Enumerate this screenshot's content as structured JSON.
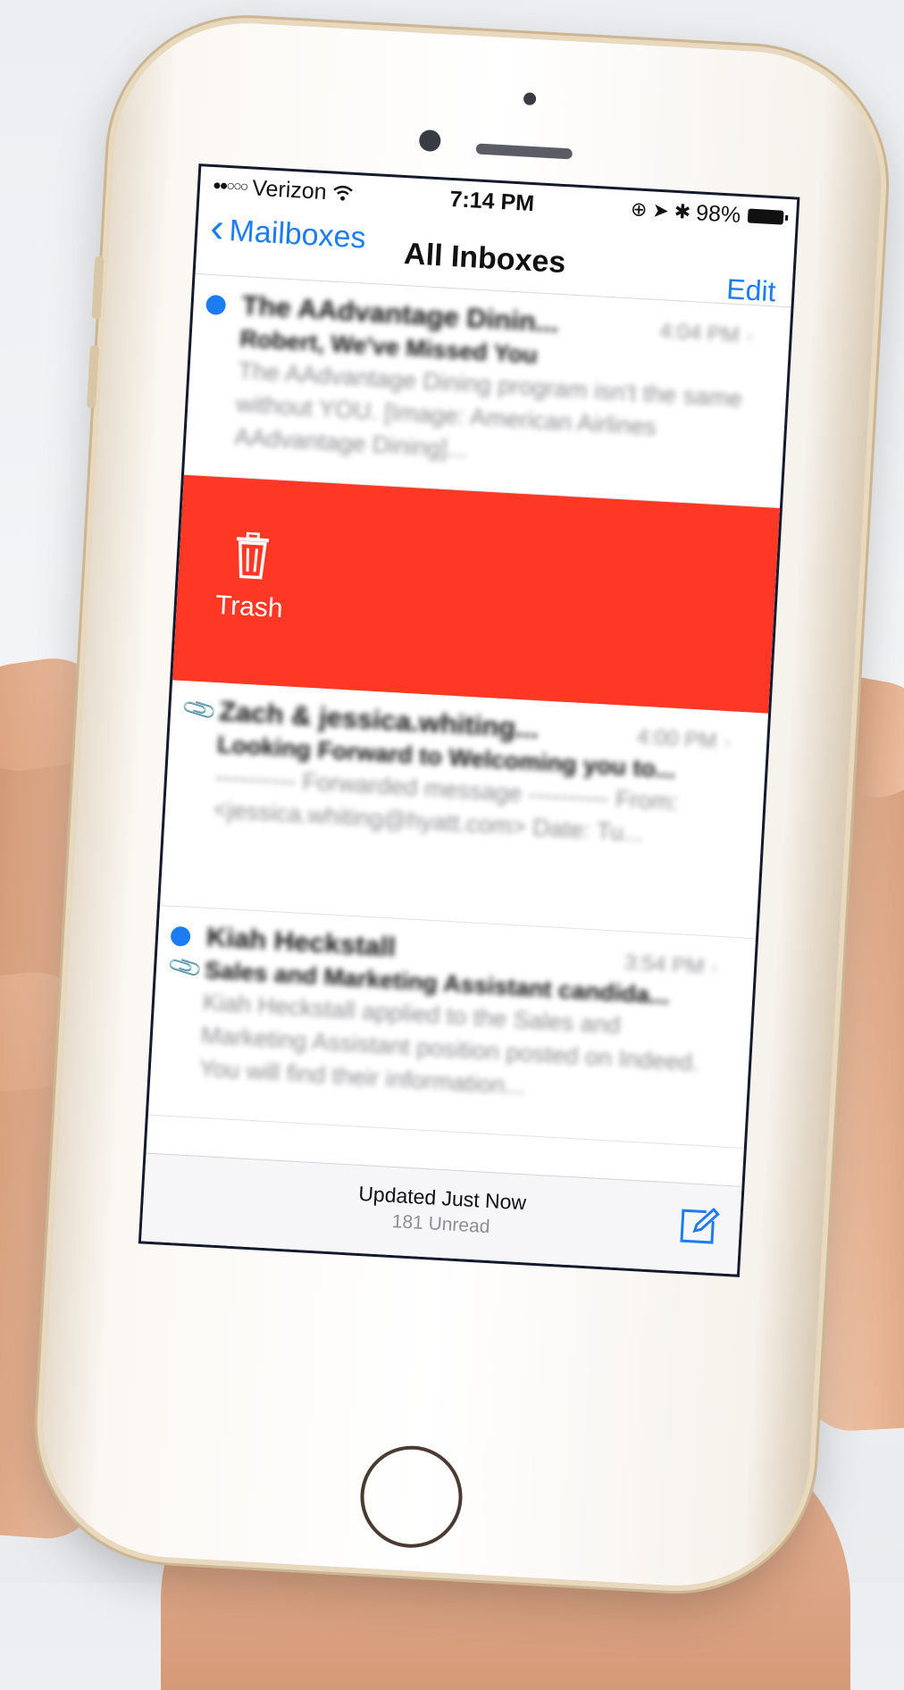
{
  "status_bar": {
    "carrier": "Verizon",
    "time": "7:14 PM",
    "battery": "98%"
  },
  "nav": {
    "back_label": "Mailboxes",
    "title": "All Inboxes",
    "edit_label": "Edit"
  },
  "messages": [
    {
      "sender": "The AAdvantage Dinin...",
      "time": "4:04 PM",
      "subject": "Robert, We've Missed You",
      "preview": "The AAdvantage Dining program isn't the same without YOU. [Image: American Airlines AAdvantage Dining]...",
      "unread": true,
      "attachment": false
    },
    {
      "sender": "Zach & jessica.whiting...",
      "time": "4:00 PM",
      "subject": "Looking Forward to Welcoming you to...",
      "preview": "---------- Forwarded message ---------- From: <jessica.whiting@hyatt.com> Date: Tu...",
      "unread": false,
      "attachment": true
    },
    {
      "sender": "Kiah Heckstall",
      "time": "3:54 PM",
      "subject": "Sales and Marketing Assistant candida...",
      "preview": "Kiah Heckstall applied to the Sales and Marketing Assistant position posted on Indeed. You will find their information...",
      "unread": true,
      "attachment": true
    }
  ],
  "swipe_action": {
    "label": "Trash",
    "icon": "trash-icon",
    "color": "#fe3824"
  },
  "toolbar": {
    "status": "Updated Just Now",
    "unread": "181 Unread"
  },
  "colors": {
    "accent": "#1e7cf2",
    "destructive": "#fe3824"
  }
}
